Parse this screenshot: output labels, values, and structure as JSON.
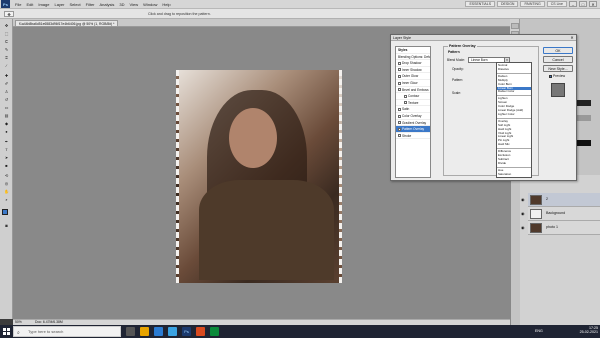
{
  "app": {
    "logo_text": "Ps",
    "menus": [
      "File",
      "Edit",
      "Image",
      "Layer",
      "Select",
      "Filter",
      "Analysis",
      "3D",
      "View",
      "Window",
      "Help"
    ],
    "workspaces": [
      "ESSENTIALS",
      "DESIGN",
      "PAINTING"
    ],
    "cs_live": "CS Live",
    "window_controls": [
      "–",
      "□",
      "✕"
    ]
  },
  "options_bar": {
    "hint": "Click and drag to reposition the pattern."
  },
  "document": {
    "tab_title": "f1a44b8ba6d51e6583d96f17e4b6406.jpg @ 50% (1, RGB/8#) *",
    "zoom": "50%",
    "doc_info": "Doc: 6.47M/6.38M"
  },
  "toolbox": {
    "icons": [
      "move-icon",
      "marquee-icon",
      "lasso-icon",
      "quick-select-icon",
      "crop-icon",
      "eyedropper-icon",
      "healing-icon",
      "brush-icon",
      "clone-stamp-icon",
      "history-brush-icon",
      "eraser-icon",
      "gradient-icon",
      "blur-icon",
      "dodge-icon",
      "pen-icon",
      "type-icon",
      "path-select-icon",
      "shape-icon",
      "3d-rotate-icon",
      "3d-camera-icon",
      "hand-icon",
      "zoom-icon"
    ]
  },
  "layer_style_dialog": {
    "title": "Layer Style",
    "close_label": "✕",
    "styles_header": "Styles",
    "styles": [
      {
        "label": "Blending Options: Default",
        "checkbox": false,
        "selected": false
      },
      {
        "label": "Drop Shadow",
        "checkbox": true,
        "selected": false
      },
      {
        "label": "Inner Shadow",
        "checkbox": true,
        "selected": false
      },
      {
        "label": "Outer Glow",
        "checkbox": true,
        "selected": false
      },
      {
        "label": "Inner Glow",
        "checkbox": true,
        "selected": false
      },
      {
        "label": "Bevel and Emboss",
        "checkbox": true,
        "selected": false
      },
      {
        "label": "Contour",
        "checkbox": true,
        "selected": false
      },
      {
        "label": "Texture",
        "checkbox": true,
        "selected": false
      },
      {
        "label": "Satin",
        "checkbox": true,
        "selected": false
      },
      {
        "label": "Color Overlay",
        "checkbox": true,
        "selected": false
      },
      {
        "label": "Gradient Overlay",
        "checkbox": true,
        "selected": false
      },
      {
        "label": "Pattern Overlay",
        "checkbox": true,
        "selected": true
      },
      {
        "label": "Stroke",
        "checkbox": true,
        "selected": false
      }
    ],
    "group_title": "Pattern Overlay",
    "group_subtitle": "Pattern",
    "blend_mode_label": "Blend Mode:",
    "blend_mode_value": "Linear Burn",
    "opacity_label": "Opacity:",
    "opacity_suffix": "%",
    "pattern_label": "Pattern:",
    "scale_label": "Scale:",
    "scale_suffix": "%",
    "snap_label": "Snap to Origin",
    "link_label": "Link with Layer",
    "ok_label": "OK",
    "cancel_label": "Cancel",
    "new_style_label": "New Style...",
    "preview_label": "Preview",
    "blend_modes": [
      [
        "Normal",
        "Dissolve"
      ],
      [
        "Darken",
        "Multiply",
        "Color Burn",
        "Linear Burn",
        "Darker Color"
      ],
      [
        "Lighten",
        "Screen",
        "Color Dodge",
        "Linear Dodge (Add)",
        "Lighter Color"
      ],
      [
        "Overlay",
        "Soft Light",
        "Hard Light",
        "Vivid Light",
        "Linear Light",
        "Pin Light",
        "Hard Mix"
      ],
      [
        "Difference",
        "Exclusion",
        "Subtract",
        "Divide"
      ],
      [
        "Hue",
        "Saturation",
        "Color",
        "Luminosity"
      ]
    ],
    "selected_blend_mode": "Linear Burn"
  },
  "layers_panel": {
    "layers": [
      {
        "name": "2",
        "selected": true
      },
      {
        "name": "Background",
        "selected": false
      },
      {
        "name": "photo 1",
        "selected": false
      }
    ]
  },
  "taskbar": {
    "search_placeholder": "Type here to search",
    "language": "ENG",
    "time": "17:25",
    "date": "25-02-2021"
  },
  "colors": {
    "selection_blue": "#3b78c8",
    "taskbar_bg": "#1f2433",
    "canvas_bg": "#898989"
  }
}
